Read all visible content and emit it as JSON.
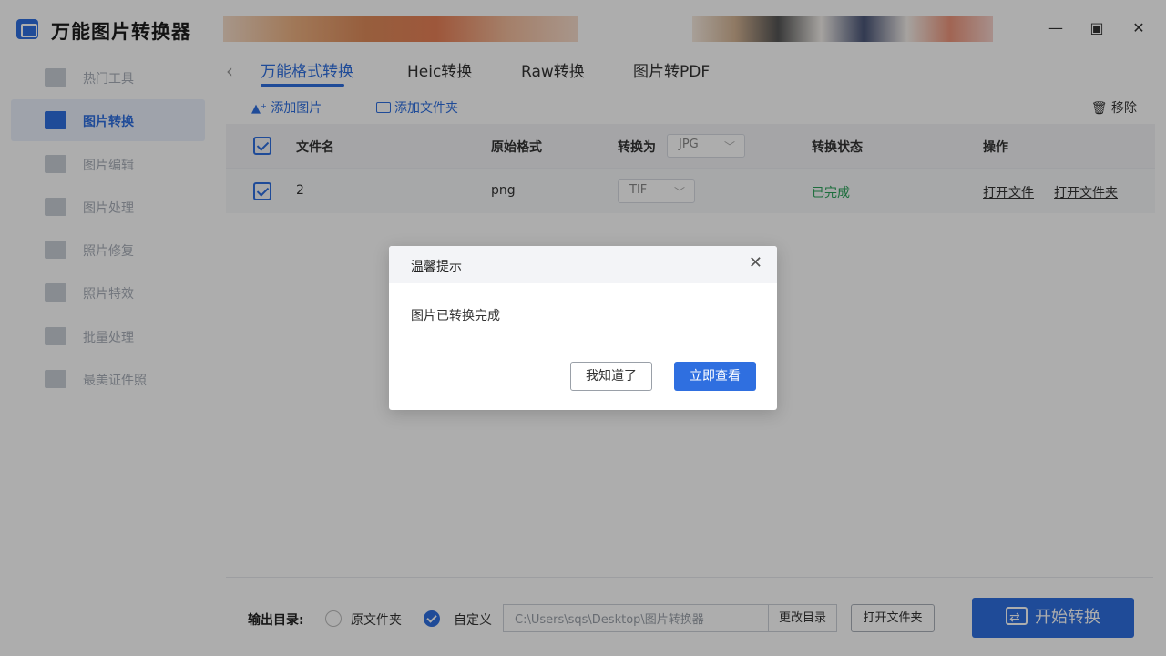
{
  "app": {
    "title": "万能图片转换器"
  },
  "sidebar": {
    "items": [
      {
        "label": "热门工具",
        "icon": "hot-tools-icon"
      },
      {
        "label": "图片转换",
        "icon": "image-convert-icon",
        "active": true
      },
      {
        "label": "图片编辑",
        "icon": "image-edit-icon"
      },
      {
        "label": "图片处理",
        "icon": "image-process-icon"
      },
      {
        "label": "照片修复",
        "icon": "photo-repair-icon"
      },
      {
        "label": "照片特效",
        "icon": "photo-effects-icon"
      },
      {
        "label": "批量处理",
        "icon": "batch-process-icon"
      },
      {
        "label": "最美证件照",
        "icon": "id-photo-icon"
      }
    ]
  },
  "tabs": [
    {
      "label": "万能格式转换",
      "active": true
    },
    {
      "label": "Heic转换"
    },
    {
      "label": "Raw转换"
    },
    {
      "label": "图片转PDF"
    }
  ],
  "toolbar": {
    "add_image": "添加图片",
    "add_folder": "添加文件夹",
    "remove": "移除"
  },
  "table": {
    "headers": {
      "filename": "文件名",
      "original_format": "原始格式",
      "convert_to": "转换为",
      "convert_to_value": "JPG",
      "status": "转换状态",
      "actions": "操作"
    },
    "rows": [
      {
        "filename": "2",
        "original_format": "png",
        "target_format": "TIF",
        "status": "已完成",
        "open_file": "打开文件",
        "open_folder": "打开文件夹"
      }
    ]
  },
  "output": {
    "label": "输出目录:",
    "option_original": "原文件夹",
    "option_custom": "自定义",
    "path": "C:\\Users\\sqs\\Desktop\\图片转换器",
    "change_dir": "更改目录",
    "open_folder": "打开文件夹",
    "start": "开始转换",
    "selected": "custom"
  },
  "dialog": {
    "title": "温馨提示",
    "message": "图片已转换完成",
    "ok": "我知道了",
    "view": "立即查看"
  },
  "colors": {
    "accent": "#2f6fe0",
    "done": "#2ca35a"
  }
}
